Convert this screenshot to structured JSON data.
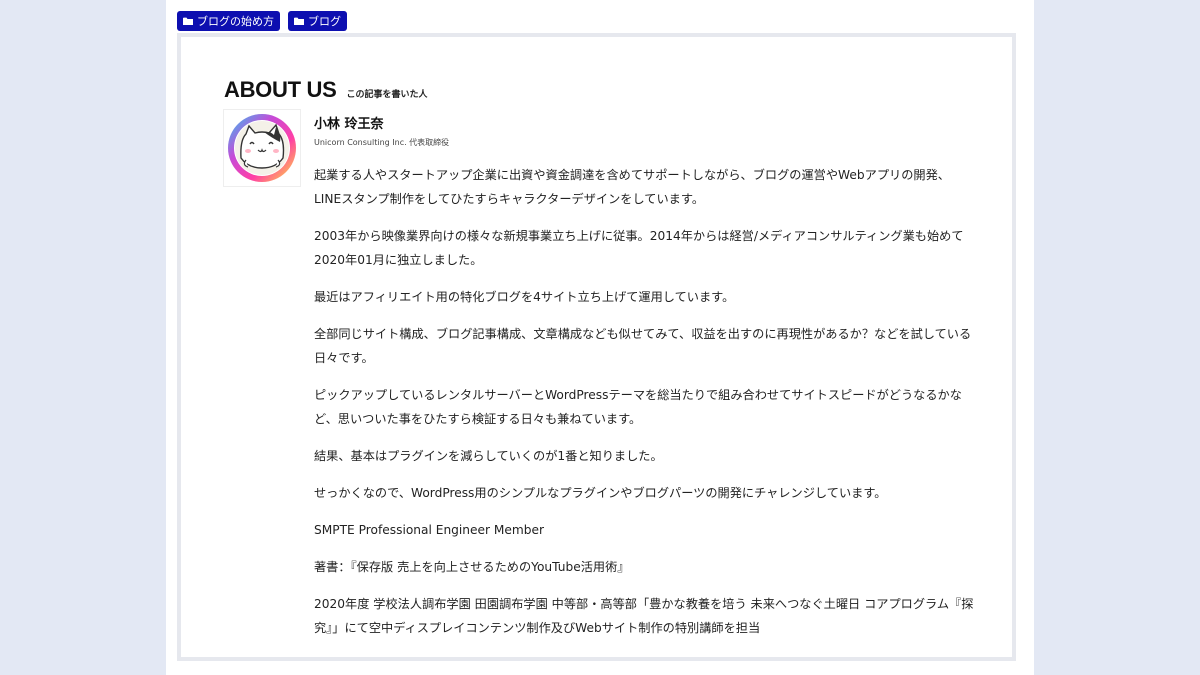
{
  "tags": [
    {
      "label": "ブログの始め方"
    },
    {
      "label": "ブログ"
    }
  ],
  "about": {
    "title": "ABOUT US",
    "subtitle": "この記事を書いた人",
    "name": "小林 玲王奈",
    "role": "Unicorn Consulting Inc. 代表取締役",
    "paragraphs": [
      "起業する人やスタートアップ企業に出資や資金調達を含めてサポートしながら、ブログの運営やWebアプリの開発、LINEスタンプ制作をしてひたすらキャラクターデザインをしています。",
      "2003年から映像業界向けの様々な新規事業立ち上げに従事。2014年からは経営/メディアコンサルティング業も始めて2020年01月に独立しました。",
      "最近はアフィリエイト用の特化ブログを4サイト立ち上げて運用しています。",
      "全部同じサイト構成、ブログ記事構成、文章構成なども似せてみて、収益を出すのに再現性があるか？などを試している日々です。",
      "ピックアップしているレンタルサーバーとWordPressテーマを総当たりで組み合わせてサイトスピードがどうなるかなど、思いついた事をひたすら検証する日々も兼ねています。",
      "結果、基本はプラグインを減らしていくのが1番と知りました。",
      "せっかくなので、WordPress用のシンプルなプラグインやブログパーツの開発にチャレンジしています。",
      "SMPTE Professional Engineer Member",
      "著書：『保存版 売上を向上させるためのYouTube活用術』",
      "2020年度 学校法人調布学園 田園調布学園 中等部・高等部「豊かな教養を培う 未来へつなぐ土曜日 コアプログラム『探究』」にて空中ディスプレイコンテンツ制作及びWebサイト制作の特別講師を担当"
    ]
  },
  "colors": {
    "tag_bg": "#0d0fb0",
    "page_bg": "#e3e8f4"
  },
  "icons": {
    "tag": "folder-icon",
    "avatar": "cat-avatar"
  }
}
